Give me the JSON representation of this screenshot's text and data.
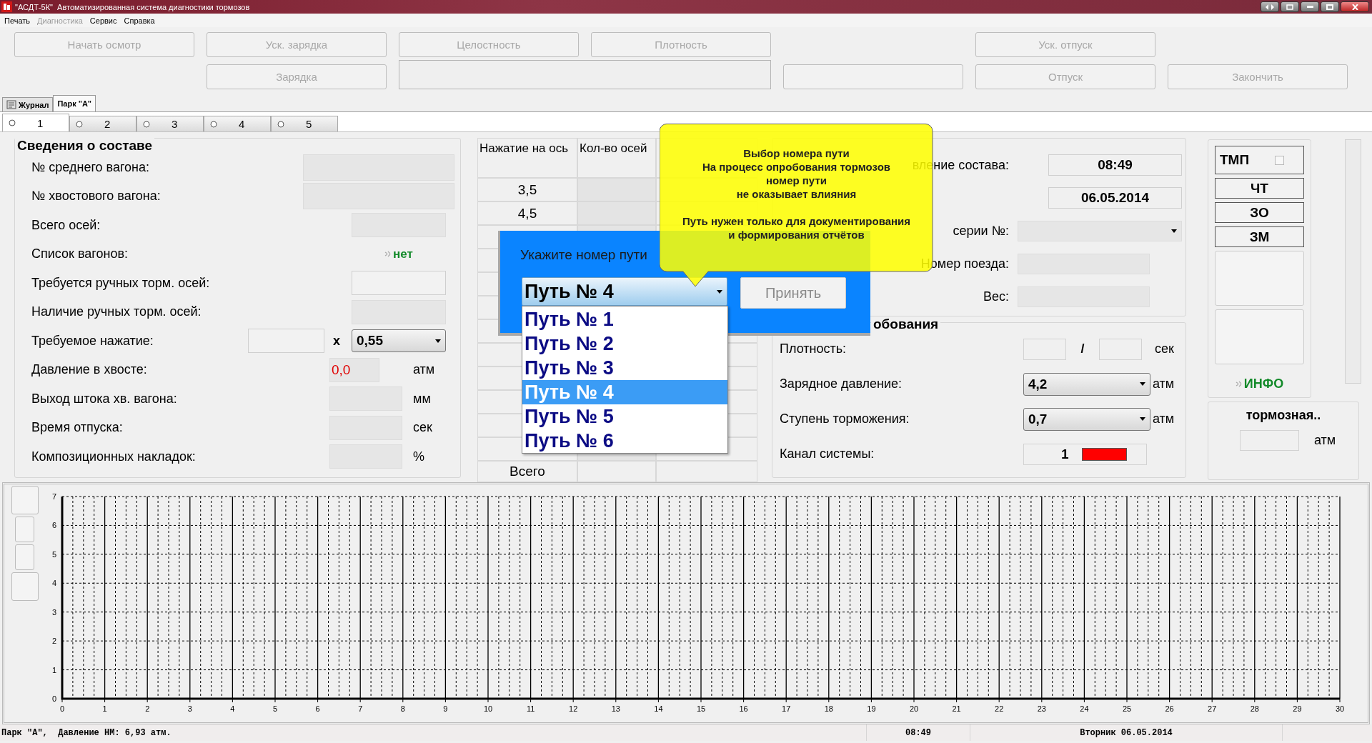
{
  "window": {
    "title": "\"АСДТ-5К\"  Автоматизированная система диагностики тормозов"
  },
  "menu": [
    {
      "label": "Печать",
      "disabled": false
    },
    {
      "label": "Диагностика",
      "disabled": true
    },
    {
      "label": "Сервис",
      "disabled": false
    },
    {
      "label": "Справка",
      "disabled": false
    }
  ],
  "toolbar": {
    "rows": [
      [
        {
          "kind": "button",
          "label": "Начать осмотр",
          "disabled": true
        },
        {
          "kind": "button",
          "label": "Уск. зарядка",
          "disabled": true
        },
        {
          "kind": "button",
          "label": "Целостность",
          "disabled": true
        },
        {
          "kind": "button",
          "label": "Плотность",
          "disabled": true
        },
        "",
        {
          "kind": "button",
          "label": "Уск. отпуск",
          "disabled": true
        },
        ""
      ],
      [
        "",
        {
          "kind": "button",
          "label": "Зарядка",
          "disabled": true
        },
        {
          "kind": "panel"
        },
        "",
        {
          "kind": "blank"
        },
        {
          "kind": "button",
          "label": "Отпуск",
          "disabled": true
        },
        {
          "kind": "button",
          "label": "Закончить",
          "disabled": true
        }
      ]
    ]
  },
  "tabs": [
    {
      "label": "Журнал",
      "selected": false
    },
    {
      "label": "Парк \"А\"",
      "selected": true
    }
  ],
  "subtabs": [
    {
      "label": "1",
      "selected": true
    },
    {
      "label": "2",
      "selected": false
    },
    {
      "label": "3",
      "selected": false
    },
    {
      "label": "4",
      "selected": false
    },
    {
      "label": "5",
      "selected": false
    }
  ],
  "composition": {
    "title": "Сведения о составе",
    "rows": [
      {
        "label": "№ среднего вагона:",
        "kind": "field"
      },
      {
        "label": "№ хвостового вагона:",
        "kind": "field"
      },
      {
        "label": "Всего осей:",
        "kind": "short"
      },
      {
        "label": "Список вагонов:",
        "kind": "flag",
        "value": "нет"
      },
      {
        "label": "Требуется ручных торм. осей:",
        "kind": "input"
      },
      {
        "label": "Наличие ручных торм. осей:",
        "kind": "short"
      },
      {
        "label": "Требуемое нажатие:",
        "kind": "coef",
        "sign": "x",
        "value": "0,55"
      },
      {
        "label": "Давление в хвосте:",
        "kind": "unit",
        "value": "0,0",
        "unit": "атм",
        "alarm": true
      },
      {
        "label": "Выход штока хв. вагона:",
        "kind": "unit",
        "unit": "мм"
      },
      {
        "label": "Время отпуска:",
        "kind": "unit",
        "unit": "сек"
      },
      {
        "label": "Композиционных накладок:",
        "kind": "unit",
        "unit": "%"
      }
    ]
  },
  "axle_table": {
    "columns": [
      "Нажатие на ось",
      "Кол-во осей"
    ],
    "rows": [
      {
        "axle_load": "3,5"
      },
      {
        "axle_load": "4,5"
      }
    ],
    "total_label": "Всего"
  },
  "train": {
    "rows": [
      {
        "kind": "value",
        "label": "вление состава:",
        "value": "08:49"
      },
      {
        "kind": "value",
        "value": "06.05.2014"
      },
      {
        "kind": "combo",
        "label": "серии №:"
      },
      {
        "kind": "field",
        "label": "Номер поезда:"
      },
      {
        "kind": "field",
        "label": "Вес:"
      }
    ]
  },
  "test": {
    "title": "обования",
    "rows": [
      {
        "kind": "pair",
        "label": "Плотность:",
        "separator": "/",
        "unit": "сек"
      },
      {
        "kind": "combo",
        "label": "Зарядное давление:",
        "value": "4,2",
        "unit": "атм"
      },
      {
        "kind": "combo",
        "label": "Ступень торможения:",
        "value": "0,7",
        "unit": "атм"
      },
      {
        "kind": "channel",
        "label": "Канал системы:",
        "value": "1",
        "color": "#ff0000"
      }
    ]
  },
  "modes": {
    "tmp": {
      "label": "ТМП",
      "checked": false
    },
    "buttons": [
      "ЧТ",
      "ЗО",
      "ЗМ"
    ],
    "info": "ИНФО"
  },
  "brake_line": {
    "title": "тормозная..",
    "unit": "атм"
  },
  "chart": {
    "chart_data": {
      "type": "line",
      "grid": true,
      "xlim": [
        0,
        30
      ],
      "ylim": [
        0,
        7
      ],
      "xticks": [
        0,
        1,
        2,
        3,
        4,
        5,
        6,
        7,
        8,
        9,
        10,
        11,
        12,
        13,
        14,
        15,
        16,
        17,
        18,
        19,
        20,
        21,
        22,
        23,
        24,
        25,
        26,
        27,
        28,
        29,
        30
      ],
      "yticks": [
        0,
        1,
        2,
        3,
        4,
        5,
        6,
        7
      ]
    }
  },
  "dialog": {
    "label": "Укажите номер пути",
    "value": "Путь № 4",
    "button": "Принять",
    "button_disabled": true,
    "options": [
      {
        "label": "Путь № 1",
        "selected": false
      },
      {
        "label": "Путь № 2",
        "selected": false
      },
      {
        "label": "Путь № 3",
        "selected": false
      },
      {
        "label": "Путь № 4",
        "selected": true
      },
      {
        "label": "Путь № 5",
        "selected": false
      },
      {
        "label": "Путь № 6",
        "selected": false
      }
    ]
  },
  "tooltip": {
    "text": "Выбор номера пути\nНа процесс опробования тормозов\nномер пути\nне оказывает влияния\n\nПуть нужен только для документирования\nи формирования отчётов"
  },
  "status_bar": {
    "pressure": "Парк \"А\",  Давление НМ: 6,93 атм.",
    "time": "08:49",
    "date": "Вторник 06.05.2014"
  }
}
